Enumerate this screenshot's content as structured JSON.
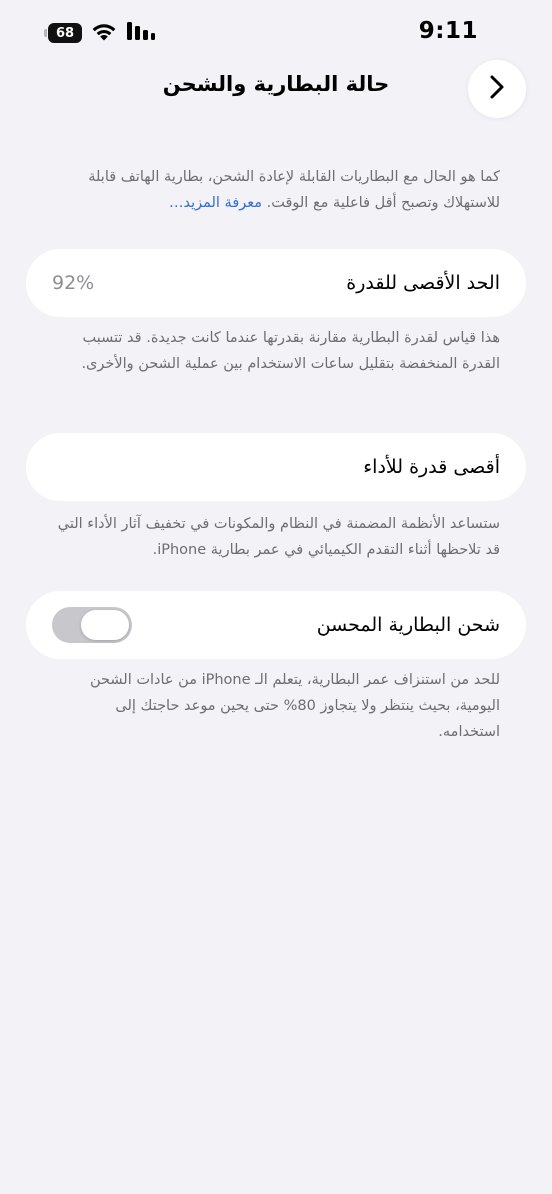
{
  "status_bar": {
    "time": "9:11",
    "battery_level": "68",
    "wifi_icon": "wifi-icon",
    "signal_icon": "cellular-signal-icon"
  },
  "nav": {
    "title": "حالة البطارية والشحن",
    "back_icon": "chevron-right-icon"
  },
  "intro": {
    "text": "كما هو الحال مع البطاريات القابلة لإعادة الشحن، بطارية الهاتف قابلة للاستهلاك وتصبح أقل فاعلية مع الوقت.",
    "link": "معرفة المزيد…"
  },
  "max_capacity": {
    "label": "الحد الأقصى للقدرة",
    "value": "92%",
    "description": "هذا قياس لقدرة البطارية مقارنة بقدرتها عندما كانت جديدة. قد تتسبب القدرة المنخفضة بتقليل ساعات الاستخدام بين عملية الشحن والأخرى."
  },
  "peak_performance": {
    "label": "أقصى قدرة للأداء",
    "description": "ستساعد الأنظمة المضمنة في النظام والمكونات في تخفيف آثار الأداء التي قد تلاحظها أثناء التقدم الكيميائي في عمر بطارية iPhone."
  },
  "optimized_charging": {
    "label": "شحن البطارية المحسن",
    "enabled": false,
    "description": "للحد من استنزاف عمر البطارية، يتعلم الـ iPhone من عادات الشحن اليومية، بحيث ينتظر ولا يتجاوز 80% حتى يحين موعد حاجتك إلى استخدامه."
  },
  "colors": {
    "background": "#f2f2f7",
    "card": "#ffffff",
    "secondary_text": "#6d6d72",
    "link": "#2f6fd6",
    "toggle_off": "#c7c7cc"
  }
}
